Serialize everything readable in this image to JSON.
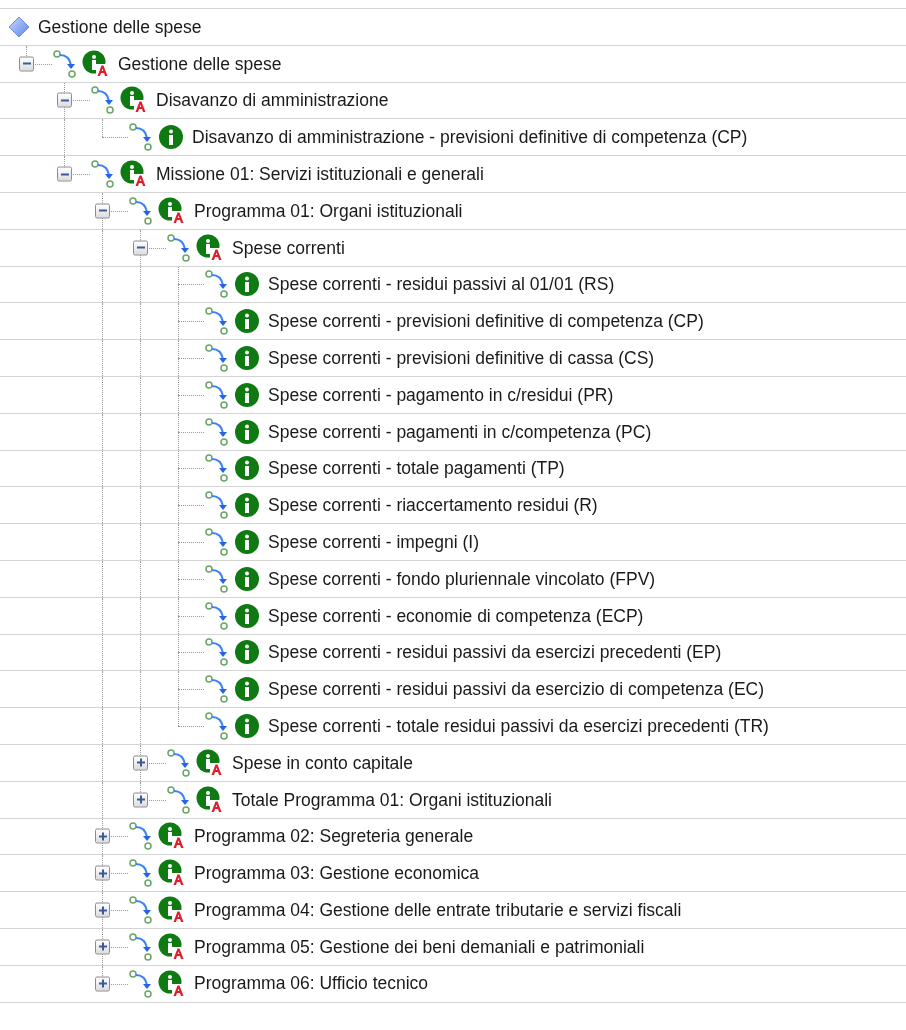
{
  "tree": {
    "label": "Gestione delle spese",
    "kind": "root",
    "children": [
      {
        "label": "Gestione delle spese",
        "kind": "aggregate",
        "expanded": true,
        "children": [
          {
            "label": "Disavanzo di amministrazione",
            "kind": "aggregate",
            "expanded": true,
            "children": [
              {
                "label": "Disavanzo di amministrazione - previsioni definitive di competenza (CP)",
                "kind": "indicator"
              }
            ]
          },
          {
            "label": "Missione 01: Servizi istituzionali e generali",
            "kind": "aggregate",
            "expanded": true,
            "children": [
              {
                "label": "Programma 01: Organi istituzionali",
                "kind": "aggregate",
                "expanded": true,
                "children": [
                  {
                    "label": "Spese correnti",
                    "kind": "aggregate",
                    "expanded": true,
                    "children": [
                      {
                        "label": "Spese correnti - residui passivi al 01/01 (RS)",
                        "kind": "indicator"
                      },
                      {
                        "label": "Spese correnti - previsioni definitive di competenza (CP)",
                        "kind": "indicator"
                      },
                      {
                        "label": "Spese correnti - previsioni definitive di cassa (CS)",
                        "kind": "indicator"
                      },
                      {
                        "label": "Spese correnti - pagamento in c/residui (PR)",
                        "kind": "indicator"
                      },
                      {
                        "label": "Spese correnti - pagamenti in c/competenza (PC)",
                        "kind": "indicator"
                      },
                      {
                        "label": "Spese correnti - totale pagamenti (TP)",
                        "kind": "indicator"
                      },
                      {
                        "label": "Spese correnti - riaccertamento residui (R)",
                        "kind": "indicator"
                      },
                      {
                        "label": "Spese correnti - impegni (I)",
                        "kind": "indicator"
                      },
                      {
                        "label": "Spese correnti - fondo pluriennale vincolato (FPV)",
                        "kind": "indicator"
                      },
                      {
                        "label": "Spese correnti - economie di competenza (ECP)",
                        "kind": "indicator"
                      },
                      {
                        "label": "Spese correnti - residui passivi da esercizi precedenti (EP)",
                        "kind": "indicator"
                      },
                      {
                        "label": "Spese correnti - residui passivi da esercizio di competenza (EC)",
                        "kind": "indicator"
                      },
                      {
                        "label": "Spese correnti - totale residui passivi da esercizi precedenti (TR)",
                        "kind": "indicator"
                      }
                    ]
                  },
                  {
                    "label": "Spese in conto capitale",
                    "kind": "aggregate",
                    "expanded": false
                  },
                  {
                    "label": "Totale Programma 01: Organi istituzionali",
                    "kind": "aggregate",
                    "expanded": false
                  }
                ]
              },
              {
                "label": "Programma 02: Segreteria generale",
                "kind": "aggregate",
                "expanded": false
              },
              {
                "label": "Programma 03: Gestione economica",
                "kind": "aggregate",
                "expanded": false
              },
              {
                "label": "Programma 04: Gestione delle entrate tributarie e servizi fiscali",
                "kind": "aggregate",
                "expanded": false
              },
              {
                "label": "Programma 05: Gestione dei beni demaniali e patrimoniali",
                "kind": "aggregate",
                "expanded": false
              },
              {
                "label": "Programma 06: Ufficio tecnico",
                "kind": "aggregate",
                "expanded": false
              }
            ]
          }
        ]
      }
    ]
  }
}
